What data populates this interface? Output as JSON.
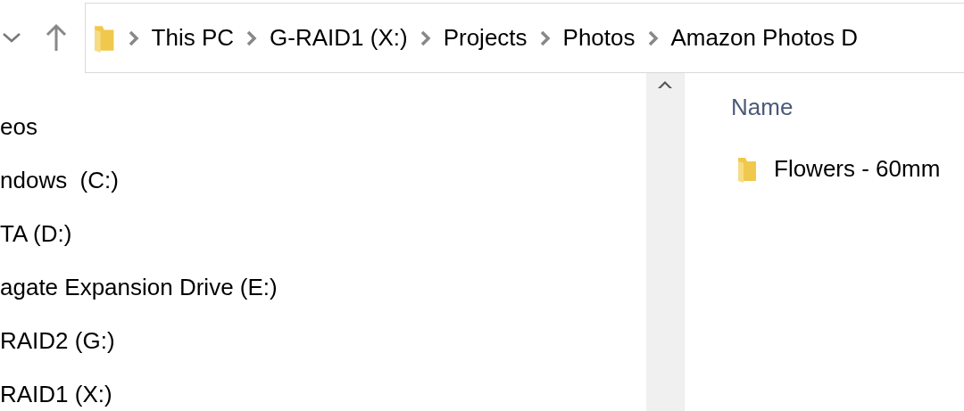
{
  "address_bar": {
    "breadcrumbs": [
      "This PC",
      "G-RAID1 (X:)",
      "Projects",
      "Photos",
      "Amazon Photos D"
    ]
  },
  "navigation_pane": {
    "items": [
      {
        "label": "eos"
      },
      {
        "label": "ndows  (C:)"
      },
      {
        "label": "TA (D:)"
      },
      {
        "label": "agate Expansion Drive (E:)"
      },
      {
        "label": "RAID2 (G:)"
      },
      {
        "label": "RAID1 (X:)"
      }
    ]
  },
  "file_list": {
    "columns": [
      "Name"
    ],
    "rows": [
      {
        "name": "Flowers - 60mm"
      }
    ]
  }
}
